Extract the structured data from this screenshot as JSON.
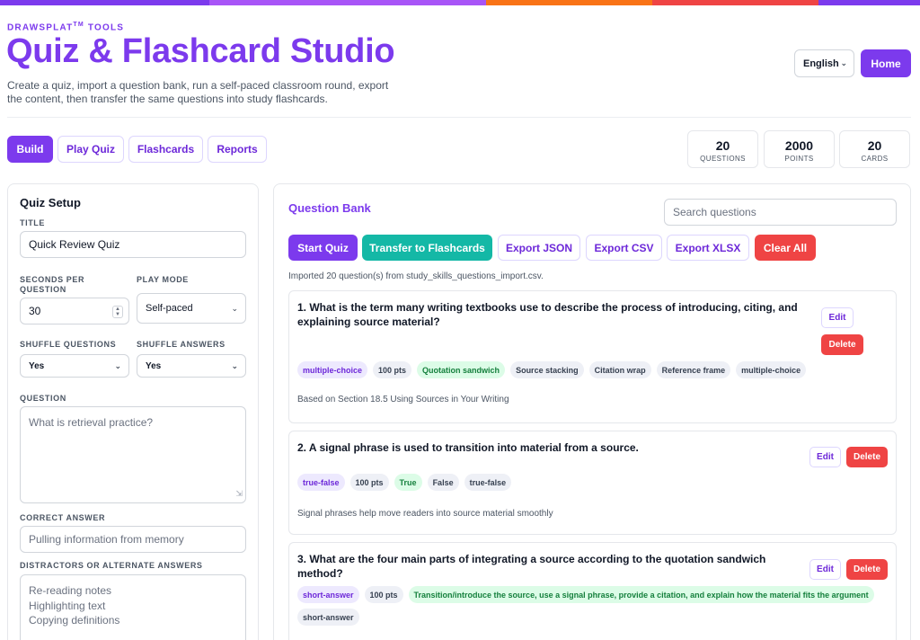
{
  "header": {
    "brand": "DRAWSPLAT",
    "brand_mark": "TM",
    "brand_suffix": " TOOLS",
    "title": "Quiz & Flashcard Studio",
    "description": "Create a quiz, import a question bank, run a self-paced classroom round, export the content, then transfer the same questions into study flashcards.",
    "language": "English",
    "home_label": "Home"
  },
  "accent_colors": [
    "#a855f7",
    "#f97316",
    "#ef4444",
    "#7c3aed"
  ],
  "tabs": [
    {
      "label": "Build"
    },
    {
      "label": "Play Quiz"
    },
    {
      "label": "Flashcards"
    },
    {
      "label": "Reports"
    }
  ],
  "stats": [
    {
      "value": "20",
      "label": "QUESTIONS"
    },
    {
      "value": "2000",
      "label": "POINTS"
    },
    {
      "value": "20",
      "label": "CARDS"
    }
  ],
  "setup": {
    "heading": "Quiz Setup",
    "title_label": "TITLE",
    "title_value": "Quick Review Quiz",
    "seconds_label": "SECONDS PER QUESTION",
    "seconds_value": "30",
    "mode_label": "PLAY MODE",
    "mode_value": "Self-paced",
    "shuffle_q_label": "SHUFFLE QUESTIONS",
    "shuffle_q_value": "Yes",
    "shuffle_a_label": "SHUFFLE ANSWERS",
    "shuffle_a_value": "Yes",
    "question_label": "QUESTION",
    "question_placeholder": "What is retrieval practice?",
    "correct_label": "CORRECT ANSWER",
    "correct_placeholder": "Pulling information from memory",
    "distractors_label": "DISTRACTORS OR ALTERNATE ANSWERS",
    "distractors_placeholder": [
      "Re-reading notes",
      "Highlighting text",
      "Copying definitions"
    ]
  },
  "bank": {
    "heading": "Question Bank",
    "search_placeholder": "Search questions",
    "actions": {
      "start": "Start Quiz",
      "transfer": "Transfer to Flashcards",
      "json": "Export JSON",
      "csv": "Export CSV",
      "xlsx": "Export XLSX",
      "clear": "Clear All"
    },
    "imported_text": "Imported 20 question(s) from study_skills_questions_import.csv.",
    "edit_label": "Edit",
    "delete_label": "Delete",
    "questions": [
      {
        "text": "1. What is the term many writing textbooks use to describe the process of introducing, citing, and explaining source material?",
        "type": "multiple-choice",
        "points": "100 pts",
        "correct": "Quotation sandwich",
        "options": [
          "Source stacking",
          "Citation wrap",
          "Reference frame"
        ],
        "tag": "multiple-choice",
        "note": "Based on Section 18.5 Using Sources in Your Writing"
      },
      {
        "text": "2. A signal phrase is used to transition into material from a source.",
        "type": "true-false",
        "points": "100 pts",
        "correct": "True",
        "options": [
          "False"
        ],
        "tag": "true-false",
        "note": "Signal phrases help move readers into source material smoothly"
      },
      {
        "text": "3. What are the four main parts of integrating a source according to the quotation sandwich method?",
        "type": "short-answer",
        "points": "100 pts",
        "correct": "Transition/introduce the source, use a signal phrase, provide a citation, and explain how the material fits the argument",
        "options": [],
        "tag": "short-answer",
        "note": ""
      }
    ]
  }
}
